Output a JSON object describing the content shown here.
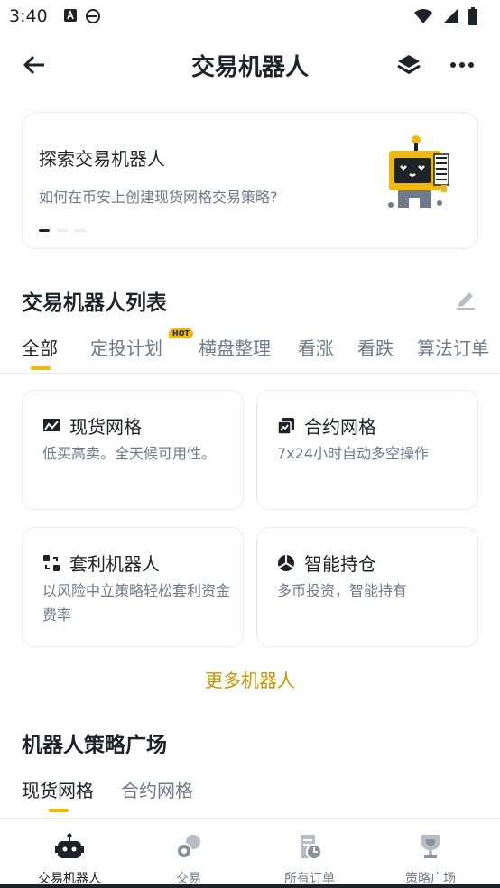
{
  "status_bar": {
    "time": "3:40"
  },
  "nav": {
    "title": "交易机器人"
  },
  "banner": {
    "title": "探索交易机器人",
    "subtitle": "如何在币安上创建现货网格交易策略?"
  },
  "bot_list": {
    "title": "交易机器人列表",
    "tabs": [
      {
        "label": "全部"
      },
      {
        "label": "定投计划",
        "badge": "HOT"
      },
      {
        "label": "横盘整理"
      },
      {
        "label": "看涨"
      },
      {
        "label": "看跌"
      },
      {
        "label": "算法订单"
      }
    ],
    "cards": [
      {
        "title": "现货网格",
        "desc": "低买高卖。全天候可用性。",
        "icon": "spot-grid-icon"
      },
      {
        "title": "合约网格",
        "desc": "7x24小时自动多空操作",
        "icon": "futures-grid-icon"
      },
      {
        "title": "套利机器人",
        "desc": "以风险中立策略轻松套利资金费率",
        "icon": "arbitrage-icon"
      },
      {
        "title": "智能持仓",
        "desc": "多币投资，智能持有",
        "icon": "portfolio-icon"
      }
    ],
    "more_label": "更多机器人"
  },
  "strategy_square": {
    "title": "机器人策略广场",
    "tabs": [
      {
        "label": "现货网格"
      },
      {
        "label": "合约网格"
      }
    ]
  },
  "bottom_nav": [
    {
      "label": "交易机器人",
      "icon": "robot-icon"
    },
    {
      "label": "交易",
      "icon": "trade-icon"
    },
    {
      "label": "所有订单",
      "icon": "orders-icon"
    },
    {
      "label": "策略广场",
      "icon": "trophy-icon"
    }
  ],
  "colors": {
    "accent": "#F0B90B",
    "link": "#C99400",
    "text": "#1E2329",
    "muted": "#707A8A"
  }
}
